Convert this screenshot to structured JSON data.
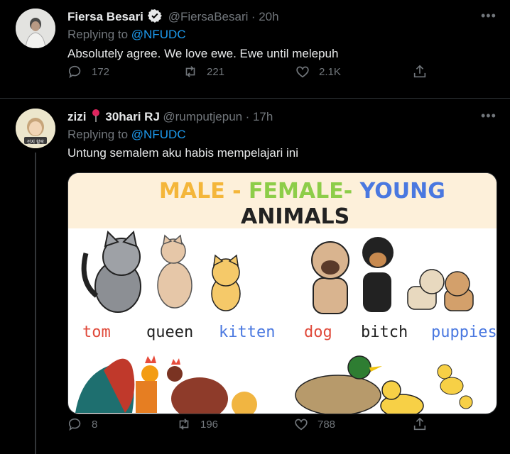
{
  "tweet1": {
    "name": "Fiersa Besari",
    "handle": "@FiersaBesari",
    "time": "· 20h",
    "replying_prefix": "Replying to",
    "replying_to": "@NFUDC",
    "text": "Absolutely agree. We love ewe. Ewe until melepuh",
    "replies": "172",
    "retweets": "221",
    "likes": "2.1K",
    "verified": true
  },
  "tweet2": {
    "name": "zizi",
    "name_suffix": "30hari RJ",
    "handle": "@rumputjepun",
    "time": "· 17h",
    "replying_prefix": "Replying to",
    "replying_to": "@NFUDC",
    "text": "Untung semalem aku habis mempelajari ini",
    "replies": "8",
    "retweets": "196",
    "likes": "788",
    "avatar_badge": "전지 할락",
    "media": {
      "title_male": "MALE -",
      "title_female": "FEMALE-",
      "title_young": "YOUNG",
      "title_line2": "ANIMALS",
      "labels": [
        "tom",
        "queen",
        "kitten",
        "dog",
        "bitch",
        "puppies"
      ]
    }
  },
  "icons": [
    "more-icon",
    "verified-badge-icon",
    "reply-icon",
    "retweet-icon",
    "like-icon",
    "share-icon",
    "location-pin-icon"
  ],
  "colors": {
    "link": "#1d9bf0",
    "muted": "#71767b",
    "male": "#f4b63a",
    "female": "#8dcd49",
    "young": "#4a78e0",
    "male_label": "#e04a3b",
    "young_label": "#4a78e0"
  }
}
